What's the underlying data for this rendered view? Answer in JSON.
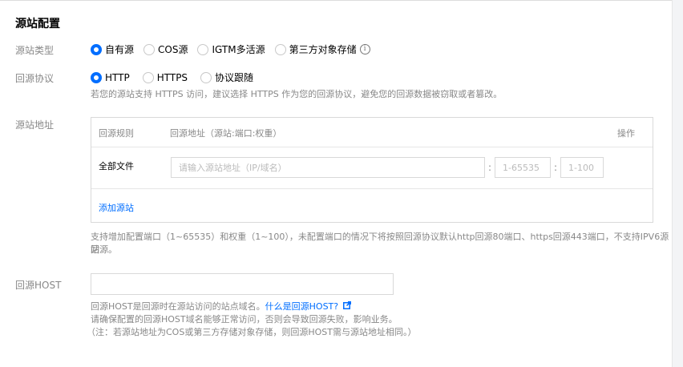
{
  "section_title": "源站配置",
  "origin_type": {
    "label": "源站类型",
    "options": [
      "自有源",
      "COS源",
      "IGTM多活源",
      "第三方对象存储"
    ],
    "selected": "自有源",
    "info_icon": "info-circle-icon"
  },
  "origin_protocol": {
    "label": "回源协议",
    "options": [
      "HTTP",
      "HTTPS",
      "协议跟随"
    ],
    "selected": "HTTP",
    "hint": "若您的源站支持 HTTPS 访问，建议选择 HTTPS 作为您的回源协议，避免您的回源数据被窃取或者篡改。"
  },
  "origin_address": {
    "label": "源站地址",
    "columns": {
      "rule": "回源规则",
      "address": "回源地址（源站:端口:权重）",
      "action": "操作"
    },
    "row": {
      "rule": "全部文件",
      "address_placeholder": "请输入源站地址（IP/域名）",
      "port_placeholder": "1-65535",
      "weight_placeholder": "1-100",
      "colon": ":"
    },
    "add_link": "添加源站",
    "hint_line1": "支持增加配置端口（1~65535）和权重（1~100），未配置端口的情况下将按照回源协议默认http回源80端口、https回源443端口，不支持IPV6源站",
    "hint_line2": "回源。"
  },
  "origin_host": {
    "label": "回源HOST",
    "value": "",
    "hint_prefix": "回源HOST是回源时在源站访问的站点域名。",
    "hint_link": "什么是回源HOST?",
    "link_icon": "external-link-icon",
    "hint_line2": "请确保配置的回源HOST域名能够正常访问，否则会导致回源失败，影响业务。",
    "hint_line3": "（注：若源站地址为COS或第三方存储对象存储，则回源HOST需与源站地址相同。）"
  },
  "colors": {
    "accent": "#006eff",
    "muted": "#888888"
  }
}
